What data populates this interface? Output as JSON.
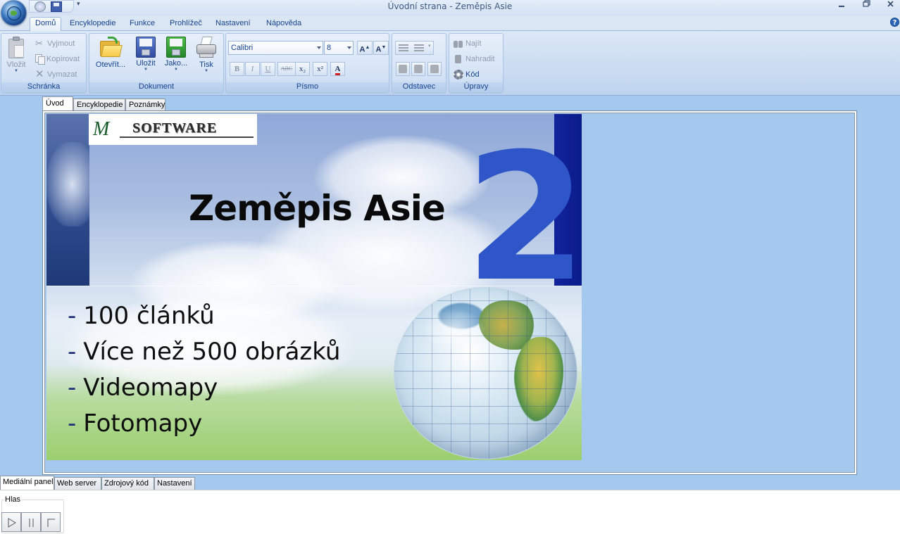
{
  "window": {
    "title": "Úvodní strana - Zeměpis Asie",
    "qat_more": "▾",
    "help": "?"
  },
  "ribbon": {
    "tabs": [
      "Domů",
      "Encyklopedie",
      "Funkce",
      "Prohlížeč",
      "Nastavení",
      "Nápověda"
    ],
    "active_tab": "Domů",
    "groups": {
      "clipboard": {
        "label": "Schránka",
        "paste": "Vložit",
        "cut": "Vyjmout",
        "copy": "Kopírovat",
        "delete": "Vymazat"
      },
      "document": {
        "label": "Dokument",
        "open": "Otevřít...",
        "save": "Uložit",
        "save_as": "Jako...",
        "print": "Tisk"
      },
      "font": {
        "label": "Písmo",
        "font_name": "Calibri",
        "font_size": "8",
        "grow": "A",
        "shrink": "A",
        "bold": "B",
        "italic": "I",
        "underline": "U",
        "strike": "ABC",
        "subscript": "x₂",
        "superscript": "x²",
        "color": "A"
      },
      "paragraph": {
        "label": "Odstavec"
      },
      "editing": {
        "label": "Úpravy",
        "find": "Najít",
        "replace": "Nahradit",
        "code": "Kód"
      }
    }
  },
  "doc_tabs": [
    "Úvod",
    "Encyklopedie",
    "Poznámky"
  ],
  "banner": {
    "logo_text": "SOFTWARE",
    "logo_mark": "M",
    "title": "Zeměpis Asie",
    "edition": "2",
    "features": [
      "100 článků",
      "Více než 500 obrázků",
      "Videomapy",
      "Fotomapy"
    ],
    "dash": "-"
  },
  "bottom_tabs": [
    "Mediální panel",
    "Web server",
    "Zdrojový kód",
    "Nastavení"
  ],
  "media_panel": {
    "group_label": "Hlas"
  },
  "colors": {
    "accent": "#15428b",
    "background": "#a5c8ee",
    "edition_blue": "#2f56c8",
    "bar_blue": "#12239c"
  }
}
